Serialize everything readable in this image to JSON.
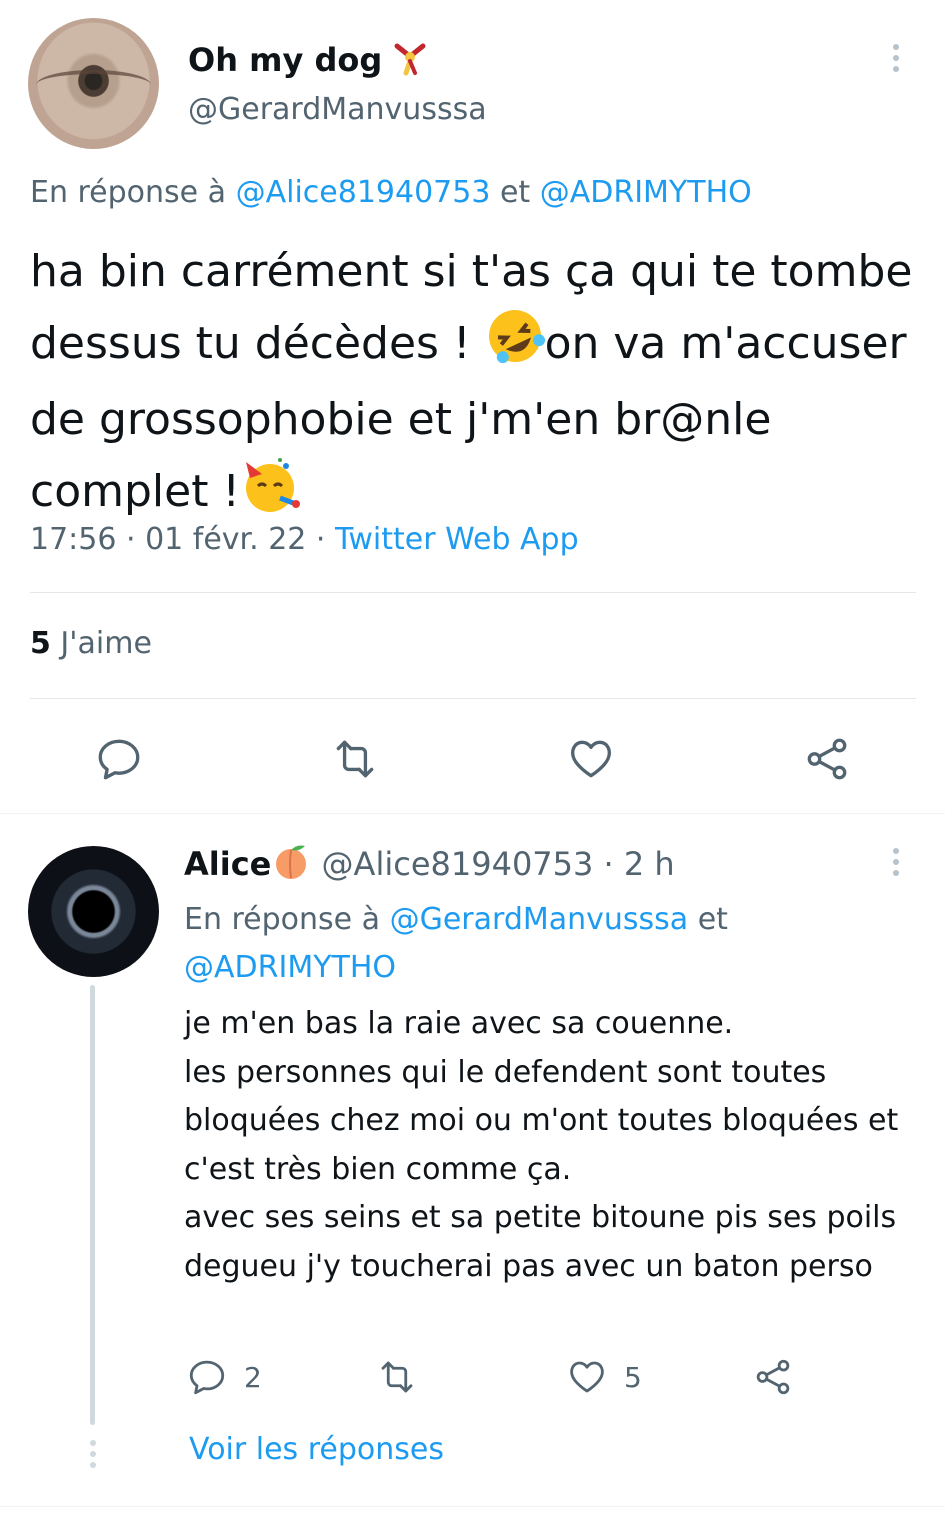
{
  "main_tweet": {
    "display_name": "Oh my dog",
    "handle": "@GerardManvusssa",
    "reply_prefix": "En réponse à ",
    "reply_mention_1": "@Alice81940753",
    "reply_and": " et ",
    "reply_mention_2": "@ADRIMYTHO",
    "text_part1": "ha bin carrément si t'as ça qui te tombe dessus tu décèdes ! ",
    "text_part2": "on va m'accuser de grossophobie et j'm'en br@nle complet !",
    "time": "17:56",
    "sep": " · ",
    "date": "01 févr. 22",
    "source": "Twitter Web App",
    "likes_count": "5",
    "likes_label": " J'aime"
  },
  "reply_tweet": {
    "display_name": "Alice",
    "handle": "@Alice81940753",
    "age": " · 2 h",
    "reply_prefix": "En réponse à ",
    "reply_mention_1": "@GerardManvusssa",
    "reply_and": " et ",
    "reply_mention_2": "@ADRIMYTHO",
    "text": "je m'en bas la raie avec sa couenne.\nles personnes qui le defendent sont toutes bloquées chez moi ou m'ont toutes bloquées et c'est très bien comme ça.\navec ses seins et sa petite bitoune pis ses poils degueu j'y toucherai pas avec un baton perso",
    "reply_count": "2",
    "like_count": "5",
    "see_replies": "Voir les réponses"
  },
  "icons": [
    "dog-emoji",
    "more-icon",
    "rofl-emoji",
    "party-face-emoji",
    "reply-icon",
    "retweet-icon",
    "like-icon",
    "share-icon",
    "peach-emoji"
  ],
  "colors": {
    "link": "#1d9bf0",
    "secondary": "#536471",
    "text": "#0f1419",
    "divider": "#eff3f4"
  }
}
